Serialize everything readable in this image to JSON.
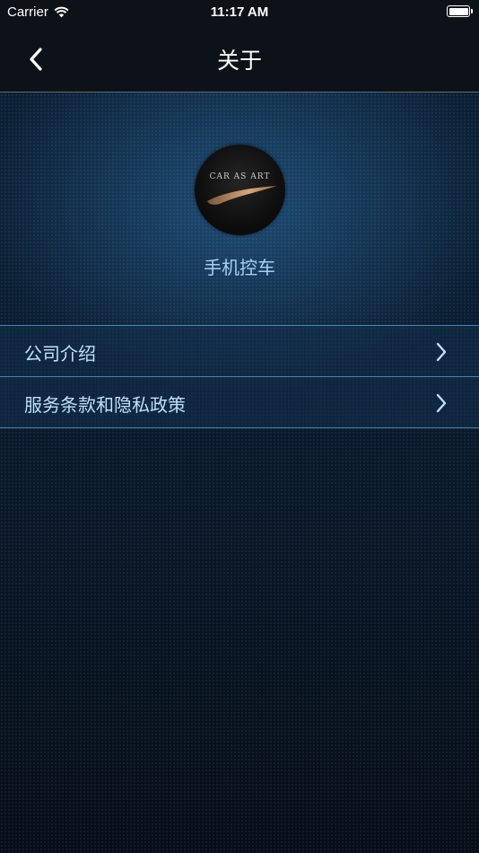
{
  "status_bar": {
    "carrier": "Carrier",
    "time": "11:17 AM",
    "icons": [
      "wifi-icon",
      "battery-icon"
    ]
  },
  "nav": {
    "title": "关于",
    "back_icon": "chevron-left-icon"
  },
  "about": {
    "logo_text": "CAR AS ART",
    "app_name": "手机控车"
  },
  "menu": {
    "items": [
      {
        "label": "公司介绍",
        "icon": "chevron-right-icon"
      },
      {
        "label": "服务条款和隐私政策",
        "icon": "chevron-right-icon"
      }
    ]
  },
  "colors": {
    "accent": "#a9cfee",
    "divider": "#4f84b0",
    "bar_background": "#0d1218"
  }
}
